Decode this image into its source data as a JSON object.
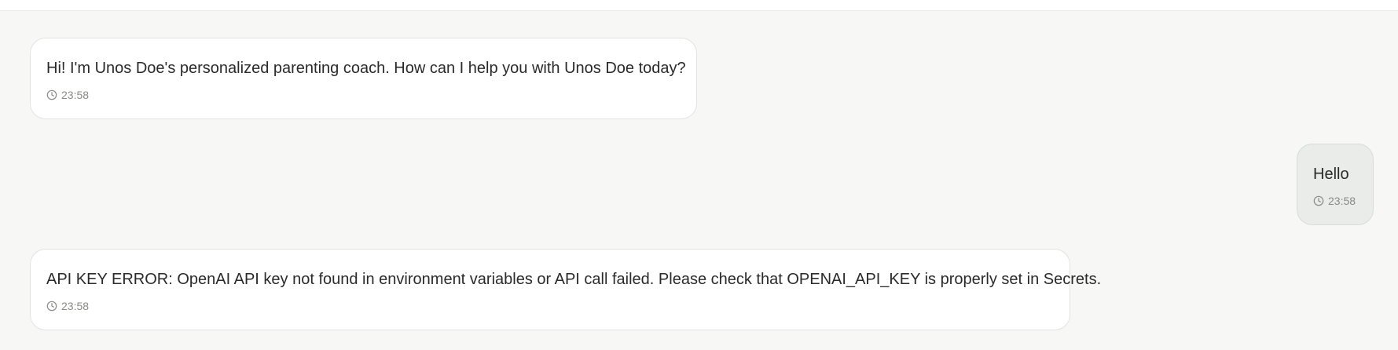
{
  "messages": [
    {
      "sender": "assistant",
      "text": "Hi! I'm Unos Doe's personalized parenting coach. How can I help you with Unos Doe today?",
      "time": "23:58"
    },
    {
      "sender": "user",
      "text": "Hello",
      "time": "23:58"
    },
    {
      "sender": "assistant",
      "text": "API KEY ERROR: OpenAI API key not found in environment variables or API call failed. Please check that OPENAI_API_KEY is properly set in Secrets.",
      "time": "23:58"
    }
  ],
  "icons": {
    "timestamp": "clock-icon"
  },
  "colors": {
    "chat_background": "#f7f7f5",
    "assistant_bubble": "#ffffff",
    "user_bubble": "#e9ece8",
    "timestamp_text": "#8a8a86"
  }
}
